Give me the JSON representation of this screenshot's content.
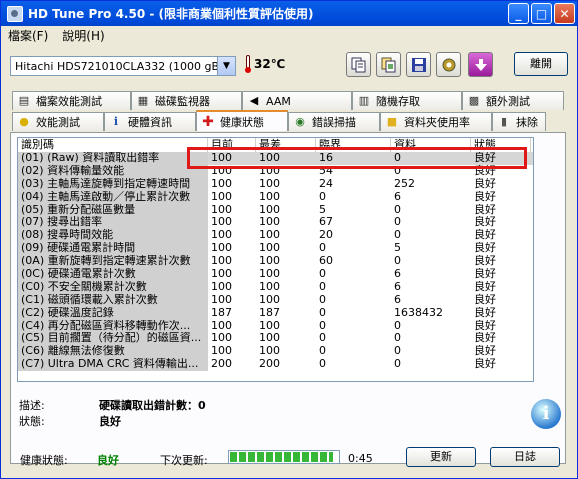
{
  "window": {
    "title": "HD Tune Pro 4.50 - (限非商業個利性質評估使用)",
    "minimize": "_",
    "maximize": "□",
    "close": "✕"
  },
  "menu": [
    "檔案(F)",
    "說明(H)"
  ],
  "toolbar": {
    "drive": "Hitachi HDS721010CLA332 (1000 gB)",
    "temperature": "32℃",
    "exit_label": "離開"
  },
  "tabs_top": [
    {
      "label": "檔案效能測試",
      "icon": "file-benchmark-icon"
    },
    {
      "label": "磁碟監視器",
      "icon": "disk-monitor-icon"
    },
    {
      "label": "AAM",
      "icon": "speaker-icon"
    },
    {
      "label": "隨機存取",
      "icon": "random-access-icon"
    },
    {
      "label": "額外測試",
      "icon": "extra-tests-icon"
    }
  ],
  "tabs_bottom": [
    {
      "label": "效能測試",
      "icon": "lightbulb-icon"
    },
    {
      "label": "硬體資訊",
      "icon": "info-icon"
    },
    {
      "label": "健康狀態",
      "icon": "health-cross-icon"
    },
    {
      "label": "錯誤掃描",
      "icon": "magnifier-icon"
    },
    {
      "label": "資料夾使用率",
      "icon": "folder-icon"
    },
    {
      "label": "抹除",
      "icon": "trash-icon"
    }
  ],
  "table": {
    "headers": [
      "識別碼",
      "目前",
      "最差",
      "臨界",
      "資料",
      "狀態"
    ],
    "rows": [
      [
        "(01) (Raw) 資料讀取出錯率",
        "100",
        "100",
        "16",
        "0",
        "良好"
      ],
      [
        "(02) 資料傳輸量效能",
        "100",
        "100",
        "54",
        "0",
        "良好"
      ],
      [
        "(03) 主軸馬達旋轉到指定轉速時間",
        "100",
        "100",
        "24",
        "252",
        "良好"
      ],
      [
        "(04) 主軸馬達啟動／停止累計次數",
        "100",
        "100",
        "0",
        "6",
        "良好"
      ],
      [
        "(05) 重新分配磁區數量",
        "100",
        "100",
        "5",
        "0",
        "良好"
      ],
      [
        "(07) 搜尋出錯率",
        "100",
        "100",
        "67",
        "0",
        "良好"
      ],
      [
        "(08) 搜尋時間效能",
        "100",
        "100",
        "20",
        "0",
        "良好"
      ],
      [
        "(09) 硬碟通電累計時間",
        "100",
        "100",
        "0",
        "5",
        "良好"
      ],
      [
        "(0A) 重新旋轉到指定轉速累計次數",
        "100",
        "100",
        "60",
        "0",
        "良好"
      ],
      [
        "(0C) 硬碟通電累計次數",
        "100",
        "100",
        "0",
        "6",
        "良好"
      ],
      [
        "(C0) 不安全關機累計次數",
        "100",
        "100",
        "0",
        "6",
        "良好"
      ],
      [
        "(C1) 磁頭循環載入累計次數",
        "100",
        "100",
        "0",
        "6",
        "良好"
      ],
      [
        "(C2) 硬碟溫度記錄",
        "187",
        "187",
        "0",
        "1638432",
        "良好"
      ],
      [
        "(C4) 再分配磁區資料移轉動作次...",
        "100",
        "100",
        "0",
        "0",
        "良好"
      ],
      [
        "(C5) 目前擱置（待分配）的磁區資...",
        "100",
        "100",
        "0",
        "0",
        "良好"
      ],
      [
        "(C6) 離線無法修復數",
        "100",
        "100",
        "0",
        "0",
        "良好"
      ],
      [
        "(C7) Ultra DMA CRC 資料傳輸出...",
        "200",
        "200",
        "0",
        "0",
        "良好"
      ]
    ]
  },
  "detail": {
    "desc_label": "描述:",
    "desc_value": "硬碟讀取出錯計數：0",
    "state_label": "狀態:",
    "state_value": "良好"
  },
  "status": {
    "health_label": "健康狀態:",
    "health_value": "良好",
    "next_label": "下次更新:",
    "progress": 0.95,
    "countdown": "0:45",
    "refresh_label": "更新",
    "log_label": "日誌"
  },
  "colors": {
    "highlight_box": "#e01818",
    "good": "#008000",
    "titlebar": "#0454e0"
  }
}
